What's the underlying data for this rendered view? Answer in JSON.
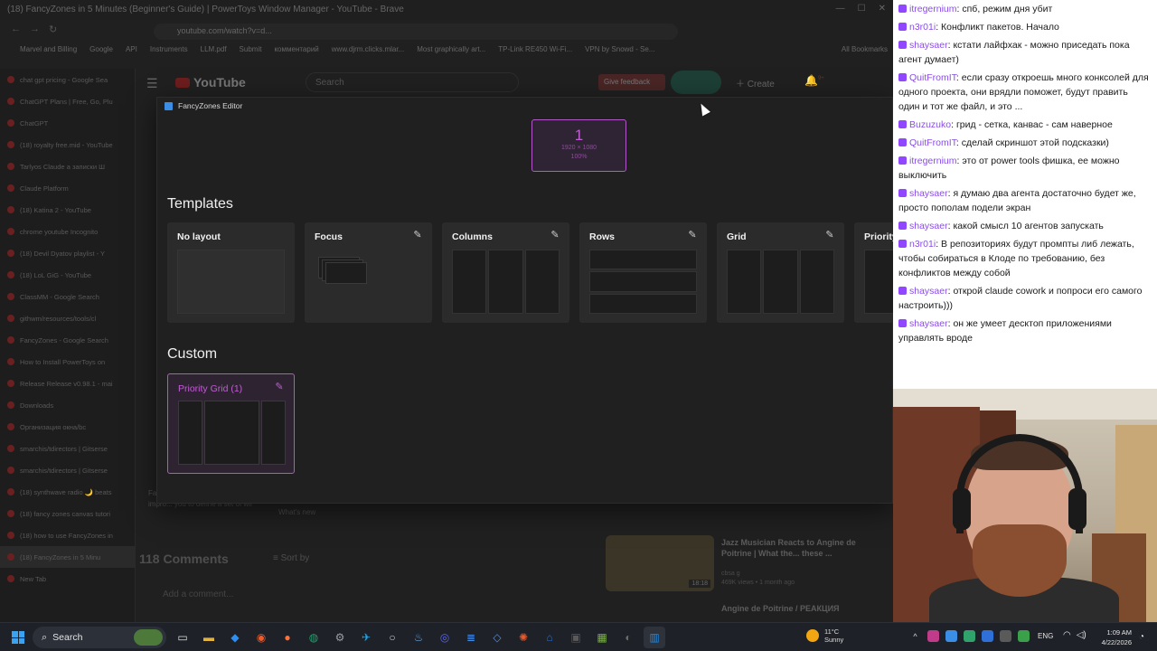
{
  "browser": {
    "window_title": "(18) FancyZones in 5 Minutes (Beginner's Guide) | PowerToys Window Manager - YouTube - Brave",
    "address": "youtube.com/watch?v=d...",
    "bookmarks": [
      "Marvel and Billing",
      "Google",
      "API",
      "Instruments",
      "LLM.pdf",
      "Submit",
      "комментарий",
      "www.djrm.clicks.mlar...",
      "Most graphically art...",
      "TP-Link RE450 Wi-Fi...",
      "VPN by Snowd - Se..."
    ],
    "all_bookmarks": "All Bookmarks",
    "tabs": [
      "chat gpt pricing - Google Sea",
      "ChatGPT Plans | Free, Go, Plu",
      "ChatGPT",
      "(18) royalty free.mid - YouTube",
      "Tarlyos Claude a записки Ш",
      "Claude Platform",
      "(18) Katina 2 - YouTube",
      "chrome youtube Incognito",
      "(18) Devil Dyatov playlist - Y",
      "(18) LoL GiG - YouTube",
      "ClassMM - Google Search",
      "githwm/resources/tools/cl",
      "FancyZones - Google Search",
      "How to Install PowerToys on",
      "Release Release v0.98.1 - mai",
      "Downloads",
      "Организация окна/bc",
      "smarchis/tdirectors | Gitserse",
      "smarchis/tdirectors | Gitserse",
      "(18) synthwave radio 🌙 beats",
      "(18) fancy zones canvas tutori",
      "(18) how to use FancyZones in",
      "(18) FancyZones in 5 Minu",
      "New Tab"
    ],
    "yt_logo": "YouTube",
    "yt_search_placeholder": "Search",
    "yt_feedback": "Give feedback",
    "yt_create": "Create",
    "yt_notifications": "9+",
    "desc_text": "FancyZones efficient layouts as impro... you to define a set of wir",
    "comments_count": "118 Comments",
    "sort_by": "Sort by",
    "add_comment": "Add a comment...",
    "whats_new": "What's new",
    "rec_title": "Jazz Musician Reacts to Angine de Poitrine | What the... these ...",
    "rec_channel": "cbsa g",
    "rec_meta": "469K views • 1 month ago",
    "rec_duration": "18:18",
    "rec2_title": "Angine de Poitrine / РЕАКЦИЯ"
  },
  "fz": {
    "title": "FancyZones Editor",
    "monitor": {
      "number": "1",
      "resolution": "1920 × 1080",
      "scale": "100%"
    },
    "templates_title": "Templates",
    "templates": [
      {
        "name": "No layout",
        "editable": false
      },
      {
        "name": "Focus",
        "editable": true
      },
      {
        "name": "Columns",
        "editable": true
      },
      {
        "name": "Rows",
        "editable": true
      },
      {
        "name": "Grid",
        "editable": true
      },
      {
        "name": "Priority",
        "editable": false
      }
    ],
    "custom_title": "Custom",
    "custom": [
      {
        "name": "Priority Grid (1)"
      }
    ],
    "accent": "#b257c7"
  },
  "chat": {
    "messages": [
      {
        "user": "itregernium",
        "text": "спб, режим дня убит"
      },
      {
        "user": "n3r01i",
        "text": "Конфликт пакетов. Начало"
      },
      {
        "user": "shaysaer",
        "text": "кстати лайфхак - можно приседать пока агент думает)"
      },
      {
        "user": "QuitFromIT",
        "text": "если сразу откроешь много конксолей для одного проекта, они врядли поможет, будут править один и тот же файл, и это ..."
      },
      {
        "user": "Buzuzuko",
        "text": "грид - сетка, канвас - сам наверное"
      },
      {
        "user": "QuitFromIT",
        "text": "сделай скриншот этой подсказки)"
      },
      {
        "user": "itregernium",
        "text": "это от power tools фишка, ее можно выключить"
      },
      {
        "user": "shaysaer",
        "text": "я думаю два агента достаточно будет же, просто пополам подели экран"
      },
      {
        "user": "shaysaer",
        "text": "какой смысл 10 агентов запускать"
      },
      {
        "user": "n3r01i",
        "text": "В репозиториях будут промпты либ лежать, чтобы собираться в Клоде по требованию, без конфликтов между собой"
      },
      {
        "user": "shaysaer",
        "text": "открой claude cowork и попроси его самого настроить)))"
      },
      {
        "user": "shaysaer",
        "text": "он же умеет десктоп приложениями управлять вроде"
      }
    ],
    "user_color": "#8a4de8"
  },
  "taskbar": {
    "search_label": "Search",
    "apps": [
      "explorer-files",
      "file-folder",
      "vscode",
      "brave",
      "firefox",
      "edge",
      "settings",
      "telegram",
      "github",
      "steam",
      "discord",
      "notepad",
      "powertoys",
      "shields",
      "powershell",
      "terminal",
      "minecraft",
      "obs",
      "fancyzones"
    ],
    "weather_temp": "11°C",
    "weather_desc": "Sunny",
    "lang": "ENG",
    "time": "1:09 AM",
    "date": "4/22/2026"
  }
}
